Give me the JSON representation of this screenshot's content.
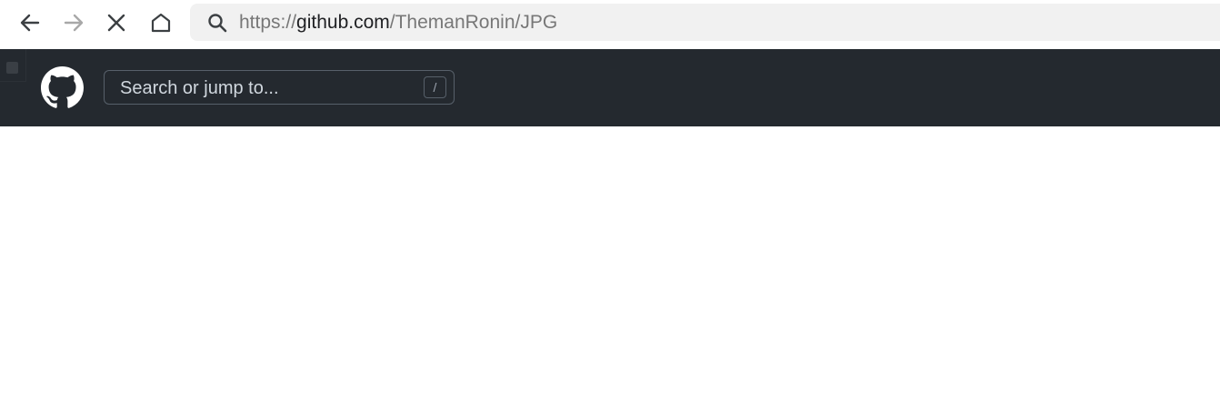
{
  "browser": {
    "url_scheme": "https://",
    "url_host": "github.com",
    "url_path": "/ThemanRonin/JPG",
    "icons": {
      "back": "arrow-left-icon",
      "forward": "arrow-right-icon",
      "stop": "close-icon",
      "home": "home-icon",
      "search": "search-icon"
    }
  },
  "github_header": {
    "logo": "github-mark-icon",
    "search_placeholder": "Search or jump to...",
    "shortcut_key": "/",
    "background_color": "#24292f"
  }
}
